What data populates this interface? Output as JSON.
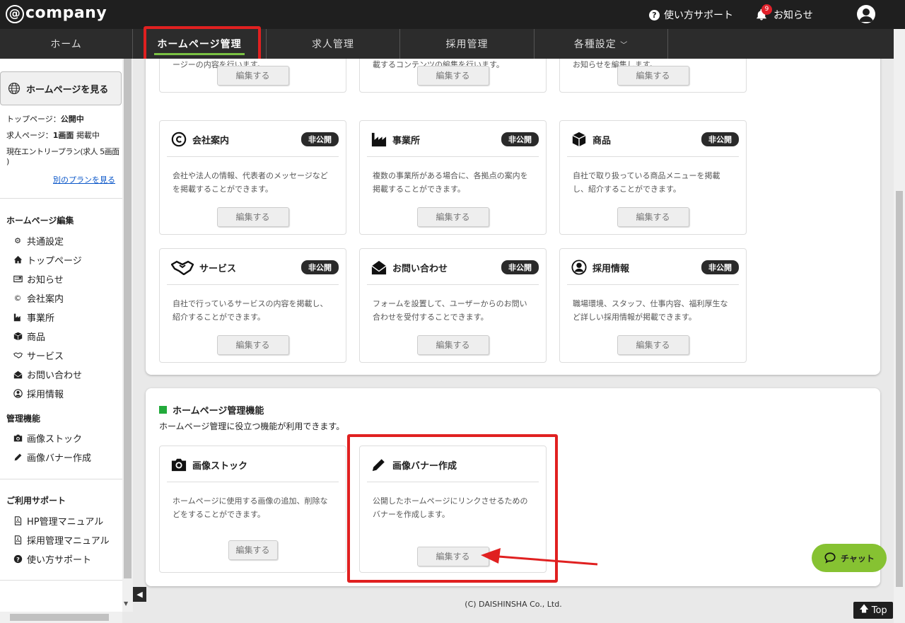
{
  "header": {
    "logo": "company",
    "logo_at": "@",
    "support": "使い方サポート",
    "news": "お知らせ",
    "news_count": "9"
  },
  "nav": {
    "home": "ホーム",
    "homepage": "ホームページ管理",
    "jobs": "求人管理",
    "recruit": "採用管理",
    "settings": "各種設定",
    "settings_chevron": "﹀"
  },
  "sidebar": {
    "view_button": "ホームページを見る",
    "status_top": "トップページ：",
    "status_top_value": "公開中",
    "status_job": "求人ページ：",
    "status_job_value": "1画面",
    "status_job_suffix": "掲載中",
    "plan": "現在エントリープラン(求人 5画面",
    "plan_close": ")",
    "other_plans": "別のプランを見る",
    "edit_heading": "ホームページ編集",
    "edit_items": [
      "共通設定",
      "トップページ",
      "お知らせ",
      "会社案内",
      "事業所",
      "商品",
      "サービス",
      "お問い合わせ",
      "採用情報"
    ],
    "manage_heading": "管理機能",
    "manage_items": [
      "画像ストック",
      "画像バナー作成"
    ],
    "support_heading": "ご利用サポート",
    "support_items": [
      "HP管理マニュアル",
      "採用管理マニュアル",
      "使い方サポート"
    ]
  },
  "cards_top": {
    "partial_desc": [
      "ージーの内容を行います。",
      "載するコンテンツの編集を行います。",
      "お知らせを編集します。"
    ],
    "edit_label": "編集する"
  },
  "cards": [
    {
      "title": "会社案内",
      "status": "非公開",
      "desc": "会社や法人の情報、代表者のメッセージなどを掲載することができます。"
    },
    {
      "title": "事業所",
      "status": "非公開",
      "desc": "複数の事業所がある場合に、各拠点の案内を掲載することができます。"
    },
    {
      "title": "商品",
      "status": "非公開",
      "desc": "自社で取り扱っている商品メニューを掲載し、紹介することができます。"
    },
    {
      "title": "サービス",
      "status": "非公開",
      "desc": "自社で行っているサービスの内容を掲載し、紹介することができます。"
    },
    {
      "title": "お問い合わせ",
      "status": "非公開",
      "desc": "フォームを設置して、ユーザーからのお問い合わせを受付することできます。"
    },
    {
      "title": "採用情報",
      "status": "非公開",
      "desc": "職場環境、スタッフ、仕事内容、福利厚生など詳しい採用情報が掲載できます。"
    }
  ],
  "tools": {
    "heading": "ホームページ管理機能",
    "subheading": "ホームページ管理に役立つ機能が利用できます。",
    "items": [
      {
        "title": "画像ストック",
        "desc": "ホームページに使用する画像の追加、削除などをすることができます。"
      },
      {
        "title": "画像バナー作成",
        "desc": "公開したホームページにリンクさせるためのバナーを作成します。"
      }
    ],
    "edit_label": "編集する"
  },
  "chat": {
    "label": "チャット"
  },
  "footer": {
    "copyright": "(C) DAISHINSHA Co., Ltd."
  },
  "to_top": {
    "label": "Top"
  },
  "collapse": {
    "label": "◀"
  }
}
